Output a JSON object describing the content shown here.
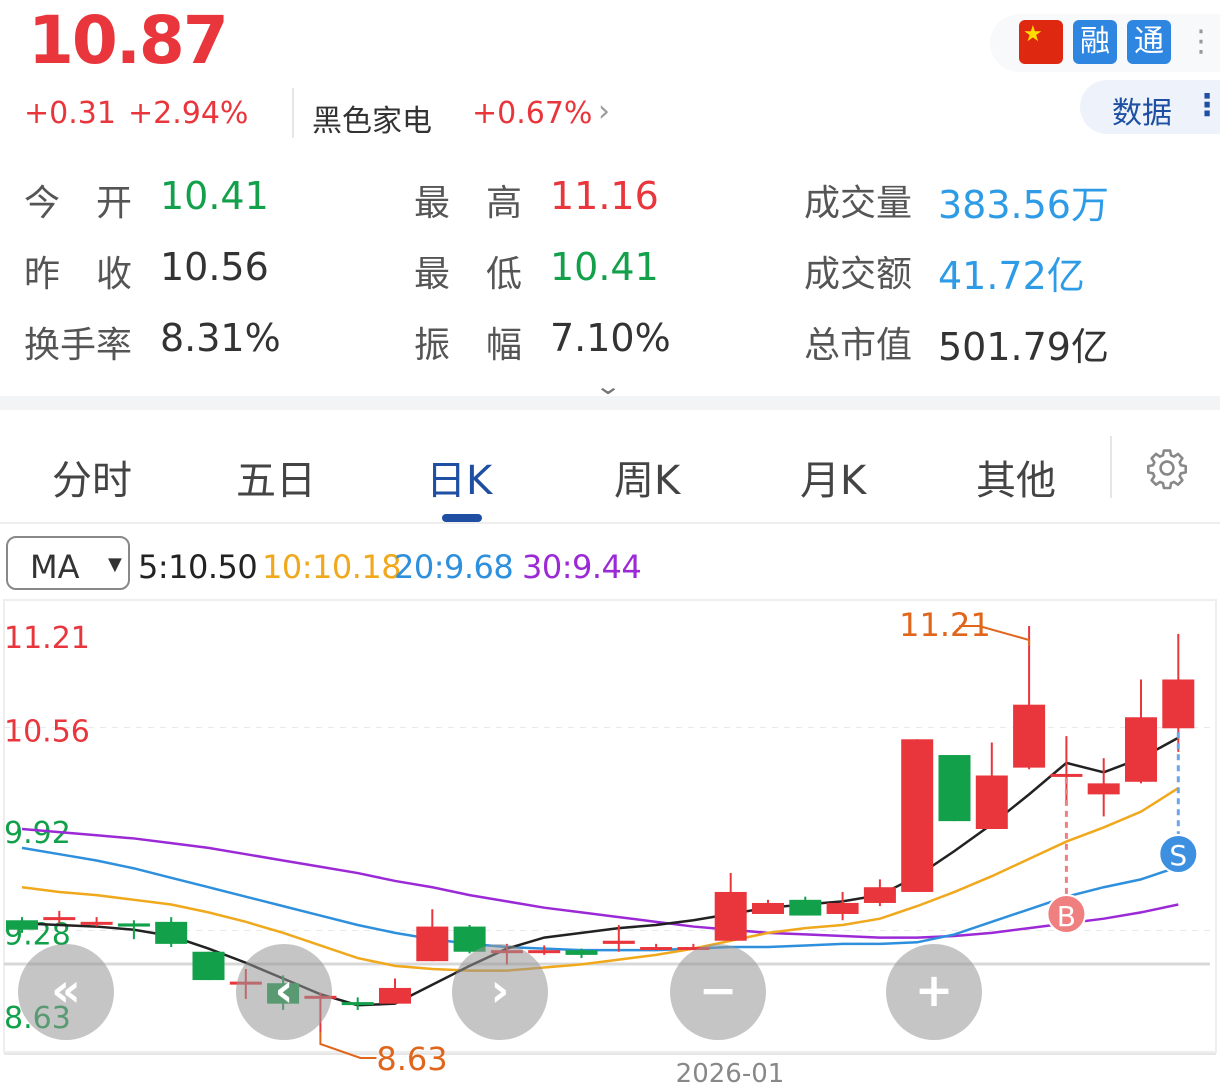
{
  "quote": {
    "price": "10.87",
    "change": "+0.31",
    "change_pct": "+2.94%",
    "sector_name": "黑色家电",
    "sector_change": "+0.67%",
    "chevron": "›"
  },
  "badges": {
    "flag_icon": "china-flag-icon",
    "flag_star": "★",
    "rong": "融",
    "tong": "通",
    "more": "⋮"
  },
  "data_button": {
    "label": "数据",
    "more": "⋮"
  },
  "stats": {
    "open_label": "今　开",
    "open": "10.41",
    "high_label": "最　高",
    "high": "11.16",
    "volume_label": "成交量",
    "volume": "383.56万",
    "prev_close_label": "昨　收",
    "prev_close": "10.56",
    "low_label": "最　低",
    "low": "10.41",
    "amount_label": "成交额",
    "amount": "41.72亿",
    "turnover_label": "换手率",
    "turnover": "8.31%",
    "amplitude_label": "振　幅",
    "amplitude": "7.10%",
    "mktcap_label": "总市值",
    "mktcap": "501.79亿",
    "expand": "⌄"
  },
  "tabs": [
    {
      "label": "分时"
    },
    {
      "label": "五日"
    },
    {
      "label": "日K"
    },
    {
      "label": "周K"
    },
    {
      "label": "月K"
    },
    {
      "label": "其他"
    }
  ],
  "active_tab": "日K",
  "ma": {
    "select_label": "MA",
    "caret": "▼",
    "ma5": "5:10.50",
    "ma10": "10:10.18",
    "ma20": "20:9.68",
    "ma30": "30:9.44"
  },
  "colors": {
    "up": "#e8363c",
    "down": "#12a04a",
    "ma5": "#222222",
    "ma10": "#f0a81c",
    "ma20": "#2e90dd",
    "ma30": "#9b2ad6",
    "annotation": "#e0661c",
    "accent": "#1e4fa3"
  },
  "chart_data": {
    "type": "candlestick",
    "y_axis_labels": [
      "11.21",
      "10.56",
      "9.92",
      "9.28",
      "8.63"
    ],
    "ylim": [
      8.63,
      11.21
    ],
    "x_label": "2026-01",
    "max_annotation": "11.21",
    "min_annotation": "8.63",
    "buy_marker": "B",
    "sell_marker": "S",
    "candles": [
      {
        "o": 9.34,
        "c": 9.28,
        "h": 9.36,
        "l": 9.26
      },
      {
        "o": 9.36,
        "c": 9.36,
        "h": 9.4,
        "l": 9.32
      },
      {
        "o": 9.33,
        "c": 9.33,
        "h": 9.36,
        "l": 9.3
      },
      {
        "o": 9.32,
        "c": 9.3,
        "h": 9.34,
        "l": 9.22
      },
      {
        "o": 9.33,
        "c": 9.19,
        "h": 9.36,
        "l": 9.17
      },
      {
        "o": 9.14,
        "c": 8.96,
        "h": 9.14,
        "l": 8.96
      },
      {
        "o": 8.95,
        "c": 8.95,
        "h": 9.03,
        "l": 8.84
      },
      {
        "o": 8.94,
        "c": 8.81,
        "h": 8.99,
        "l": 8.77
      },
      {
        "o": 8.86,
        "c": 8.86,
        "h": 8.88,
        "l": 8.63
      },
      {
        "o": 8.82,
        "c": 8.81,
        "h": 8.85,
        "l": 8.77
      },
      {
        "o": 8.81,
        "c": 8.91,
        "h": 8.97,
        "l": 8.81
      },
      {
        "o": 9.08,
        "c": 9.3,
        "h": 9.41,
        "l": 9.08
      },
      {
        "o": 9.3,
        "c": 9.14,
        "h": 9.31,
        "l": 9.13
      },
      {
        "o": 9.15,
        "c": 9.15,
        "h": 9.19,
        "l": 9.06
      },
      {
        "o": 9.15,
        "c": 9.15,
        "h": 9.18,
        "l": 9.12
      },
      {
        "o": 9.15,
        "c": 9.12,
        "h": 9.16,
        "l": 9.1
      },
      {
        "o": 9.19,
        "c": 9.21,
        "h": 9.31,
        "l": 9.14
      },
      {
        "o": 9.17,
        "c": 9.17,
        "h": 9.19,
        "l": 9.16
      },
      {
        "o": 9.17,
        "c": 9.17,
        "h": 9.19,
        "l": 9.15
      },
      {
        "o": 9.21,
        "c": 9.52,
        "h": 9.64,
        "l": 9.21
      },
      {
        "o": 9.38,
        "c": 9.45,
        "h": 9.47,
        "l": 9.38
      },
      {
        "o": 9.47,
        "c": 9.37,
        "h": 9.49,
        "l": 9.37
      },
      {
        "o": 9.38,
        "c": 9.45,
        "h": 9.52,
        "l": 9.34
      },
      {
        "o": 9.45,
        "c": 9.55,
        "h": 9.6,
        "l": 9.43
      },
      {
        "o": 9.52,
        "c": 10.49,
        "h": 10.49,
        "l": 9.52
      },
      {
        "o": 10.39,
        "c": 9.97,
        "h": 10.39,
        "l": 9.97
      },
      {
        "o": 9.92,
        "c": 10.26,
        "h": 10.47,
        "l": 9.92
      },
      {
        "o": 10.31,
        "c": 10.71,
        "h": 11.21,
        "l": 10.3
      },
      {
        "o": 10.27,
        "c": 10.27,
        "h": 10.51,
        "l": 10.09
      },
      {
        "o": 10.14,
        "c": 10.21,
        "h": 10.37,
        "l": 10.0
      },
      {
        "o": 10.22,
        "c": 10.63,
        "h": 10.87,
        "l": 10.21
      },
      {
        "o": 10.56,
        "c": 10.87,
        "h": 11.16,
        "l": 10.41
      }
    ],
    "ma5": [
      9.32,
      9.31,
      9.3,
      9.28,
      9.24,
      9.16,
      9.07,
      8.97,
      8.87,
      8.8,
      8.81,
      8.93,
      9.05,
      9.16,
      9.23,
      9.26,
      9.29,
      9.31,
      9.34,
      9.38,
      9.42,
      9.44,
      9.46,
      9.5,
      9.62,
      9.78,
      9.95,
      10.14,
      10.34,
      10.28,
      10.37,
      10.5
    ],
    "ma10": [
      9.55,
      9.52,
      9.5,
      9.47,
      9.44,
      9.39,
      9.33,
      9.26,
      9.18,
      9.1,
      9.05,
      9.03,
      9.02,
      9.02,
      9.04,
      9.06,
      9.09,
      9.12,
      9.16,
      9.21,
      9.26,
      9.29,
      9.31,
      9.35,
      9.43,
      9.52,
      9.62,
      9.73,
      9.84,
      9.93,
      10.03,
      10.18
    ],
    "ma20": [
      9.8,
      9.76,
      9.72,
      9.67,
      9.61,
      9.55,
      9.49,
      9.43,
      9.37,
      9.31,
      9.26,
      9.22,
      9.19,
      9.17,
      9.16,
      9.15,
      9.15,
      9.15,
      9.16,
      9.17,
      9.17,
      9.18,
      9.19,
      9.19,
      9.2,
      9.25,
      9.33,
      9.41,
      9.49,
      9.55,
      9.6,
      9.68
    ],
    "ma30": [
      9.92,
      9.9,
      9.88,
      9.86,
      9.83,
      9.8,
      9.76,
      9.72,
      9.68,
      9.64,
      9.59,
      9.55,
      9.5,
      9.46,
      9.42,
      9.39,
      9.36,
      9.33,
      9.3,
      9.28,
      9.26,
      9.25,
      9.24,
      9.23,
      9.23,
      9.24,
      9.26,
      9.29,
      9.32,
      9.35,
      9.39,
      9.44
    ]
  },
  "controls": {
    "prev_fast": "«",
    "prev": "‹",
    "next": "›",
    "zoom_out": "−",
    "zoom_in": "+"
  }
}
